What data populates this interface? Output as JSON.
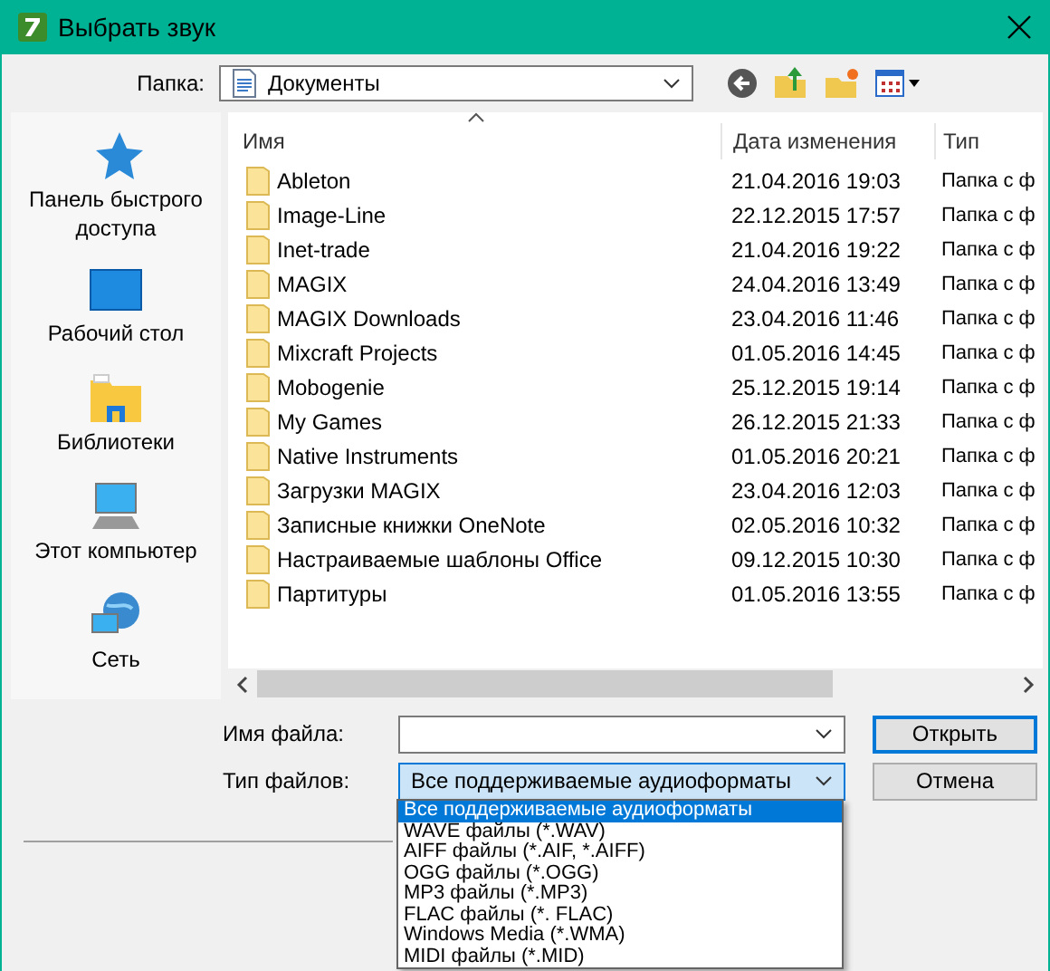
{
  "window": {
    "title": "Выбрать звук"
  },
  "folder": {
    "label": "Папка:",
    "value": "Документы"
  },
  "sidebar": {
    "items": [
      {
        "label": "Панель быстрого доступа",
        "kind": "star"
      },
      {
        "label": "Рабочий стол",
        "kind": "desktop"
      },
      {
        "label": "Библиотеки",
        "kind": "library"
      },
      {
        "label": "Этот компьютер",
        "kind": "computer"
      },
      {
        "label": "Сеть",
        "kind": "network"
      }
    ]
  },
  "table": {
    "columns": [
      "Имя",
      "Дата изменения",
      "Тип"
    ],
    "rows": [
      {
        "name": "Ableton",
        "date": "21.04.2016 19:03",
        "type": "Папка с ф"
      },
      {
        "name": "Image-Line",
        "date": "22.12.2015 17:57",
        "type": "Папка с ф"
      },
      {
        "name": "Inet-trade",
        "date": "21.04.2016 19:22",
        "type": "Папка с ф"
      },
      {
        "name": "MAGIX",
        "date": "24.04.2016 13:49",
        "type": "Папка с ф"
      },
      {
        "name": "MAGIX Downloads",
        "date": "23.04.2016 11:46",
        "type": "Папка с ф"
      },
      {
        "name": "Mixcraft Projects",
        "date": "01.05.2016 14:45",
        "type": "Папка с ф"
      },
      {
        "name": "Mobogenie",
        "date": "25.12.2015 19:14",
        "type": "Папка с ф"
      },
      {
        "name": "My Games",
        "date": "26.12.2015 21:33",
        "type": "Папка с ф"
      },
      {
        "name": "Native Instruments",
        "date": "01.05.2016 20:21",
        "type": "Папка с ф"
      },
      {
        "name": "Загрузки MAGIX",
        "date": "23.04.2016 12:03",
        "type": "Папка с ф"
      },
      {
        "name": "Записные книжки OneNote",
        "date": "02.05.2016 10:32",
        "type": "Папка с ф"
      },
      {
        "name": "Настраиваемые шаблоны Office",
        "date": "09.12.2015 10:30",
        "type": "Папка с ф"
      },
      {
        "name": "Партитуры",
        "date": "01.05.2016 13:55",
        "type": "Папка с ф"
      }
    ]
  },
  "file_name": {
    "label": "Имя файла:"
  },
  "file_type": {
    "label": "Тип файлов:",
    "value": "Все поддерживаемые аудиоформаты",
    "options": [
      {
        "label": "Все поддерживаемые аудиоформаты",
        "selected": true
      },
      {
        "label": "WAVE файлы (*.WAV)",
        "selected": false
      },
      {
        "label": "AIFF файлы (*.AIF, *.AIFF)",
        "selected": false
      },
      {
        "label": "OGG файлы (*.OGG)",
        "selected": false
      },
      {
        "label": "MP3 файлы (*.MP3)",
        "selected": false
      },
      {
        "label": "FLAC файлы (*. FLAC)",
        "selected": false
      },
      {
        "label": "Windows Media (*.WMA)",
        "selected": false
      },
      {
        "label": "MIDI файлы (*.MID)",
        "selected": false
      }
    ]
  },
  "buttons": {
    "open": "Открыть",
    "cancel": "Отмена"
  }
}
